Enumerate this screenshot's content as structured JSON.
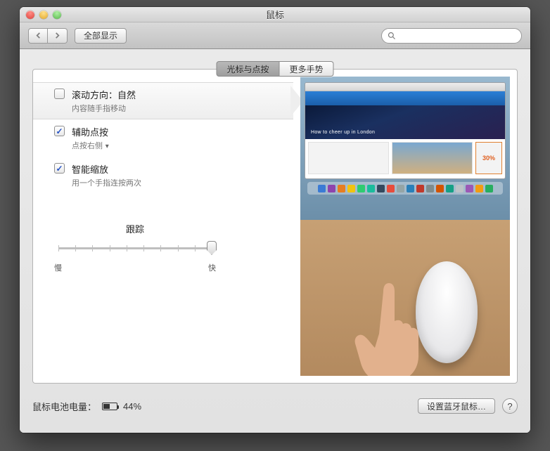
{
  "window": {
    "title": "鼠标"
  },
  "toolbar": {
    "show_all": "全部显示"
  },
  "search": {
    "value": "",
    "placeholder": ""
  },
  "tabs": [
    {
      "label": "光标与点按",
      "active": true
    },
    {
      "label": "更多手势",
      "active": false
    }
  ],
  "options": [
    {
      "key": "scroll",
      "title": "滚动方向：自然",
      "subtitle": "内容随手指移动",
      "checked": false,
      "selected": true,
      "dropdown": false
    },
    {
      "key": "secondary",
      "title": "辅助点按",
      "subtitle": "点按右侧",
      "checked": true,
      "selected": false,
      "dropdown": true
    },
    {
      "key": "smartzoom",
      "title": "智能缩放",
      "subtitle": "用一个手指连按两次",
      "checked": true,
      "selected": false,
      "dropdown": false
    }
  ],
  "tracking": {
    "label": "跟踪",
    "slow": "慢",
    "fast": "快",
    "value": 9,
    "max": 9
  },
  "preview": {
    "hero_caption": "How to cheer up in London",
    "sale_text": "30%"
  },
  "footer": {
    "battery_label": "鼠标电池电量：",
    "battery_pct": "44%",
    "battery_value": 44,
    "bluetooth_btn": "设置蓝牙鼠标…"
  },
  "colors": {
    "dock_icons": [
      "#3a7bd5",
      "#8e44ad",
      "#e67e22",
      "#f1c40f",
      "#2ecc71",
      "#1abc9c",
      "#34495e",
      "#e74c3c",
      "#95a5a6",
      "#2980b9",
      "#c0392b",
      "#7f8c8d",
      "#d35400",
      "#16a085",
      "#bdc3c7",
      "#9b59b6",
      "#f39c12",
      "#27ae60"
    ]
  }
}
